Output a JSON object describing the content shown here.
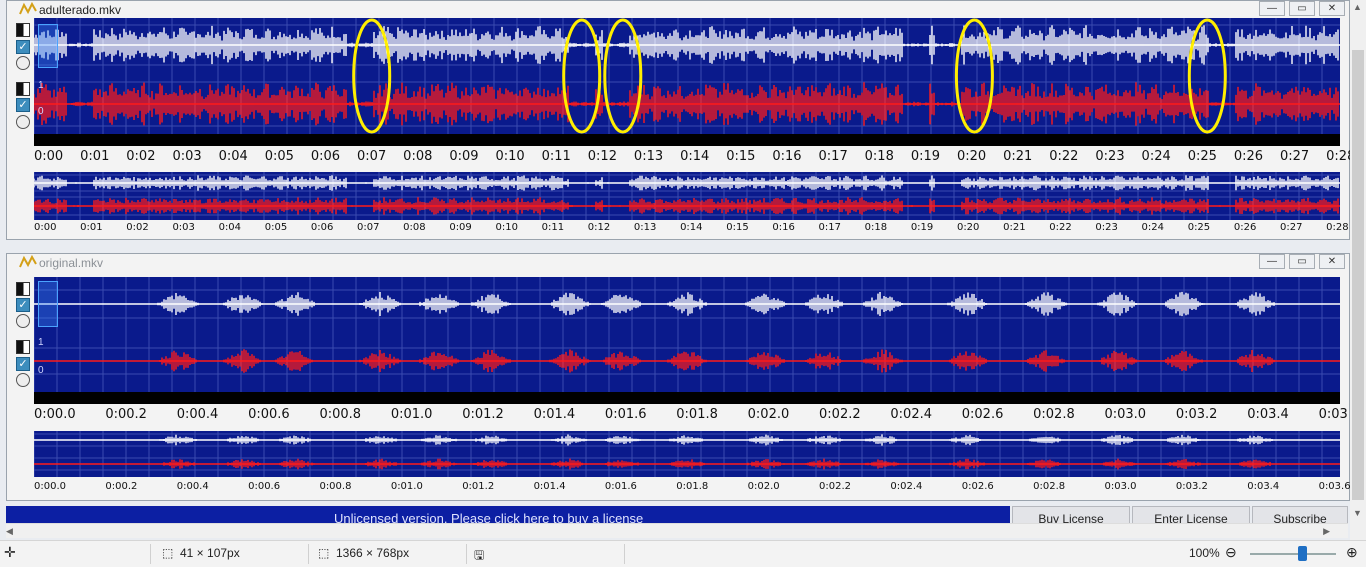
{
  "window1": {
    "title": "adulterado.mkv",
    "channel_scale": [
      "1",
      "0"
    ],
    "ruler_labels": [
      "0:00",
      "0:01",
      "0:02",
      "0:03",
      "0:04",
      "0:05",
      "0:06",
      "0:07",
      "0:08",
      "0:09",
      "0:10",
      "0:11",
      "0:12",
      "0:13",
      "0:14",
      "0:15",
      "0:16",
      "0:17",
      "0:18",
      "0:19",
      "0:20",
      "0:21",
      "0:22",
      "0:23",
      "0:24",
      "0:25",
      "0:26",
      "0:27",
      "0:28"
    ],
    "overview_labels": [
      "0:00",
      "0:01",
      "0:02",
      "0:03",
      "0:04",
      "0:05",
      "0:06",
      "0:07",
      "0:08",
      "0:09",
      "0:10",
      "0:11",
      "0:12",
      "0:13",
      "0:14",
      "0:15",
      "0:16",
      "0:17",
      "0:18",
      "0:19",
      "0:20",
      "0:21",
      "0:22",
      "0:23",
      "0:24",
      "0:25",
      "0:26",
      "0:27",
      "0:28"
    ],
    "annotation_times": [
      7.0,
      11.6,
      12.5,
      20.2,
      25.3
    ]
  },
  "window2": {
    "title": "original.mkv",
    "channel_scale": [
      "1",
      "0"
    ],
    "ruler_labels": [
      "0:00.0",
      "0:00.2",
      "0:00.4",
      "0:00.6",
      "0:00.8",
      "0:01.0",
      "0:01.2",
      "0:01.4",
      "0:01.6",
      "0:01.8",
      "0:02.0",
      "0:02.2",
      "0:02.4",
      "0:02.6",
      "0:02.8",
      "0:03.0",
      "0:03.2",
      "0:03.4",
      "0:03"
    ],
    "overview_labels": [
      "0:00.0",
      "0:00.2",
      "0:00.4",
      "0:00.6",
      "0:00.8",
      "0:01.0",
      "0:01.2",
      "0:01.4",
      "0:01.6",
      "0:01.8",
      "0:02.0",
      "0:02.2",
      "0:02.4",
      "0:02.6",
      "0:02.8",
      "0:03.0",
      "0:03.2",
      "0:03.4",
      "0:03.6"
    ]
  },
  "license": {
    "message": "Unlicensed version. Please click here to buy a license",
    "buy_label": "Buy License",
    "enter_label": "Enter License",
    "subscribe_label": "Subscribe"
  },
  "status": {
    "selection_size": "41 × 107px",
    "image_size": "1366 × 768px",
    "zoom": "100%",
    "zoom_level": 0.6
  },
  "colors": {
    "track_bg": "#0a1a8c",
    "wave_left": "#ffffff",
    "wave_right": "#ff1a1a",
    "annotation": "#ffee00"
  }
}
